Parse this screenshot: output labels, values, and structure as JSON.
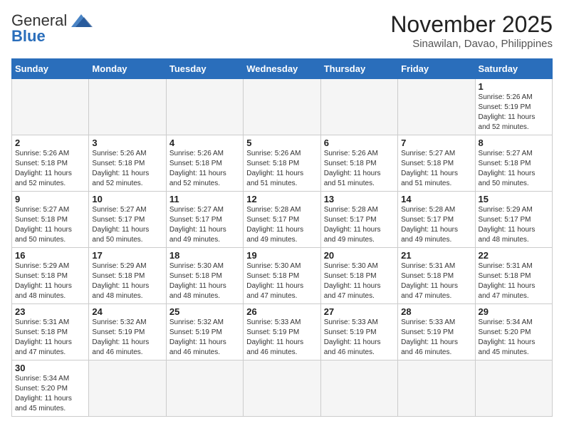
{
  "logo": {
    "general": "General",
    "blue": "Blue"
  },
  "title": "November 2025",
  "location": "Sinawilan, Davao, Philippines",
  "weekdays": [
    "Sunday",
    "Monday",
    "Tuesday",
    "Wednesday",
    "Thursday",
    "Friday",
    "Saturday"
  ],
  "weeks": [
    [
      {
        "day": "",
        "info": ""
      },
      {
        "day": "",
        "info": ""
      },
      {
        "day": "",
        "info": ""
      },
      {
        "day": "",
        "info": ""
      },
      {
        "day": "",
        "info": ""
      },
      {
        "day": "",
        "info": ""
      },
      {
        "day": "1",
        "info": "Sunrise: 5:26 AM\nSunset: 5:19 PM\nDaylight: 11 hours\nand 52 minutes."
      }
    ],
    [
      {
        "day": "2",
        "info": "Sunrise: 5:26 AM\nSunset: 5:18 PM\nDaylight: 11 hours\nand 52 minutes."
      },
      {
        "day": "3",
        "info": "Sunrise: 5:26 AM\nSunset: 5:18 PM\nDaylight: 11 hours\nand 52 minutes."
      },
      {
        "day": "4",
        "info": "Sunrise: 5:26 AM\nSunset: 5:18 PM\nDaylight: 11 hours\nand 52 minutes."
      },
      {
        "day": "5",
        "info": "Sunrise: 5:26 AM\nSunset: 5:18 PM\nDaylight: 11 hours\nand 51 minutes."
      },
      {
        "day": "6",
        "info": "Sunrise: 5:26 AM\nSunset: 5:18 PM\nDaylight: 11 hours\nand 51 minutes."
      },
      {
        "day": "7",
        "info": "Sunrise: 5:27 AM\nSunset: 5:18 PM\nDaylight: 11 hours\nand 51 minutes."
      },
      {
        "day": "8",
        "info": "Sunrise: 5:27 AM\nSunset: 5:18 PM\nDaylight: 11 hours\nand 50 minutes."
      }
    ],
    [
      {
        "day": "9",
        "info": "Sunrise: 5:27 AM\nSunset: 5:18 PM\nDaylight: 11 hours\nand 50 minutes."
      },
      {
        "day": "10",
        "info": "Sunrise: 5:27 AM\nSunset: 5:17 PM\nDaylight: 11 hours\nand 50 minutes."
      },
      {
        "day": "11",
        "info": "Sunrise: 5:27 AM\nSunset: 5:17 PM\nDaylight: 11 hours\nand 49 minutes."
      },
      {
        "day": "12",
        "info": "Sunrise: 5:28 AM\nSunset: 5:17 PM\nDaylight: 11 hours\nand 49 minutes."
      },
      {
        "day": "13",
        "info": "Sunrise: 5:28 AM\nSunset: 5:17 PM\nDaylight: 11 hours\nand 49 minutes."
      },
      {
        "day": "14",
        "info": "Sunrise: 5:28 AM\nSunset: 5:17 PM\nDaylight: 11 hours\nand 49 minutes."
      },
      {
        "day": "15",
        "info": "Sunrise: 5:29 AM\nSunset: 5:17 PM\nDaylight: 11 hours\nand 48 minutes."
      }
    ],
    [
      {
        "day": "16",
        "info": "Sunrise: 5:29 AM\nSunset: 5:18 PM\nDaylight: 11 hours\nand 48 minutes."
      },
      {
        "day": "17",
        "info": "Sunrise: 5:29 AM\nSunset: 5:18 PM\nDaylight: 11 hours\nand 48 minutes."
      },
      {
        "day": "18",
        "info": "Sunrise: 5:30 AM\nSunset: 5:18 PM\nDaylight: 11 hours\nand 48 minutes."
      },
      {
        "day": "19",
        "info": "Sunrise: 5:30 AM\nSunset: 5:18 PM\nDaylight: 11 hours\nand 47 minutes."
      },
      {
        "day": "20",
        "info": "Sunrise: 5:30 AM\nSunset: 5:18 PM\nDaylight: 11 hours\nand 47 minutes."
      },
      {
        "day": "21",
        "info": "Sunrise: 5:31 AM\nSunset: 5:18 PM\nDaylight: 11 hours\nand 47 minutes."
      },
      {
        "day": "22",
        "info": "Sunrise: 5:31 AM\nSunset: 5:18 PM\nDaylight: 11 hours\nand 47 minutes."
      }
    ],
    [
      {
        "day": "23",
        "info": "Sunrise: 5:31 AM\nSunset: 5:18 PM\nDaylight: 11 hours\nand 47 minutes."
      },
      {
        "day": "24",
        "info": "Sunrise: 5:32 AM\nSunset: 5:19 PM\nDaylight: 11 hours\nand 46 minutes."
      },
      {
        "day": "25",
        "info": "Sunrise: 5:32 AM\nSunset: 5:19 PM\nDaylight: 11 hours\nand 46 minutes."
      },
      {
        "day": "26",
        "info": "Sunrise: 5:33 AM\nSunset: 5:19 PM\nDaylight: 11 hours\nand 46 minutes."
      },
      {
        "day": "27",
        "info": "Sunrise: 5:33 AM\nSunset: 5:19 PM\nDaylight: 11 hours\nand 46 minutes."
      },
      {
        "day": "28",
        "info": "Sunrise: 5:33 AM\nSunset: 5:19 PM\nDaylight: 11 hours\nand 46 minutes."
      },
      {
        "day": "29",
        "info": "Sunrise: 5:34 AM\nSunset: 5:20 PM\nDaylight: 11 hours\nand 45 minutes."
      }
    ],
    [
      {
        "day": "30",
        "info": "Sunrise: 5:34 AM\nSunset: 5:20 PM\nDaylight: 11 hours\nand 45 minutes."
      },
      {
        "day": "",
        "info": ""
      },
      {
        "day": "",
        "info": ""
      },
      {
        "day": "",
        "info": ""
      },
      {
        "day": "",
        "info": ""
      },
      {
        "day": "",
        "info": ""
      },
      {
        "day": "",
        "info": ""
      }
    ]
  ]
}
